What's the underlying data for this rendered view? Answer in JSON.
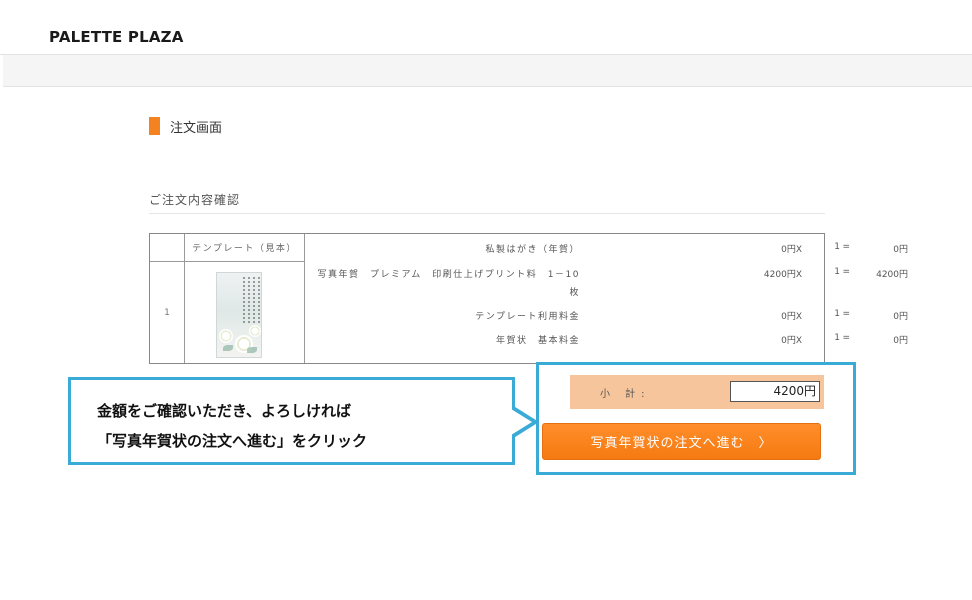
{
  "header": {
    "logo": "PALETTE PLAZA"
  },
  "page": {
    "title": "注文画面",
    "section_title": "ご注文内容確認"
  },
  "order_table": {
    "template_header": "テンプレート（見本）",
    "row_number": "1",
    "items": [
      {
        "name": "私製はがき（年賀）",
        "name2": "",
        "price": "0円X",
        "qty": "1",
        "eq": "=",
        "amount": "0円"
      },
      {
        "name": "写真年賀　プレミアム　印刷仕上げプリント料　1－10",
        "name2": "枚",
        "price": "4200円X",
        "qty": "1",
        "eq": "=",
        "amount": "4200円"
      },
      {
        "name": "テンプレート利用料金",
        "name2": "",
        "price": "0円X",
        "qty": "1",
        "eq": "=",
        "amount": "0円"
      },
      {
        "name": "年賀状　基本料金",
        "name2": "",
        "price": "0円X",
        "qty": "1",
        "eq": "=",
        "amount": "0円"
      }
    ]
  },
  "subtotal": {
    "label": "小 計:",
    "value": "4200円"
  },
  "proceed_button": {
    "label": "写真年賀状の注文へ進む",
    "chevron": "〉"
  },
  "callout": {
    "line1": "金額をご確認いただき、よろしければ",
    "line2": "「写真年賀状の注文へ進む」をクリック"
  },
  "colors": {
    "accent": "#f58220",
    "highlight": "#3aaad6",
    "subtotal_bg": "#f7c59b"
  }
}
